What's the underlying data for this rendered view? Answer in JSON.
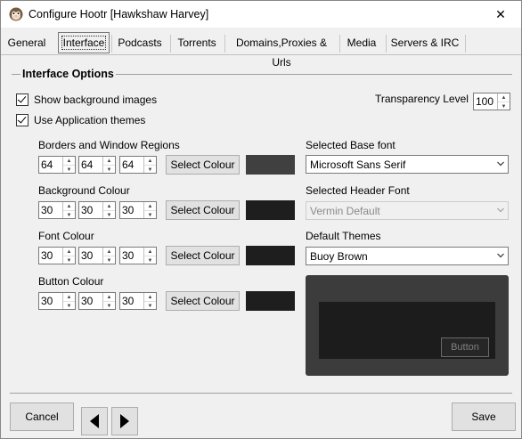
{
  "window": {
    "title": "Configure Hootr [Hawkshaw Harvey]",
    "close_glyph": "✕"
  },
  "tabs": [
    {
      "label": "General"
    },
    {
      "label": "Interface"
    },
    {
      "label": "Podcasts"
    },
    {
      "label": "Torrents"
    },
    {
      "label": "Domains,Proxies & Urls"
    },
    {
      "label": "Media"
    },
    {
      "label": "Servers & IRC"
    }
  ],
  "section": {
    "title": "Interface Options"
  },
  "options": {
    "show_bg_images": "Show background images",
    "use_app_themes": "Use Application themes",
    "transparency_label": "Transparency Level",
    "transparency_value": "100"
  },
  "colour_groups": [
    {
      "label": "Borders and Window Regions",
      "values": [
        "64",
        "64",
        "64"
      ],
      "button": "Select Colour",
      "swatch": "#404040"
    },
    {
      "label": "Background Colour",
      "values": [
        "30",
        "30",
        "30"
      ],
      "button": "Select Colour",
      "swatch": "#1e1e1e"
    },
    {
      "label": "Font Colour",
      "values": [
        "30",
        "30",
        "30"
      ],
      "button": "Select Colour",
      "swatch": "#1e1e1e"
    },
    {
      "label": "Button Colour",
      "values": [
        "30",
        "30",
        "30"
      ],
      "button": "Select Colour",
      "swatch": "#1e1e1e"
    }
  ],
  "fonts": {
    "base_label": "Selected Base font",
    "base_value": "Microsoft Sans Serif",
    "header_label": "Selected Header Font",
    "header_value": "Vermin Default",
    "themes_label": "Default Themes",
    "themes_value": "Buoy Brown"
  },
  "preview": {
    "button_label": "Button"
  },
  "footer": {
    "cancel": "Cancel",
    "save": "Save",
    "prev_glyph": "◀",
    "next_glyph": "▶"
  },
  "colors": {
    "accent": "#0078d7",
    "preview_outer": "#3c3c3c",
    "preview_inner": "#1c1c1c"
  }
}
